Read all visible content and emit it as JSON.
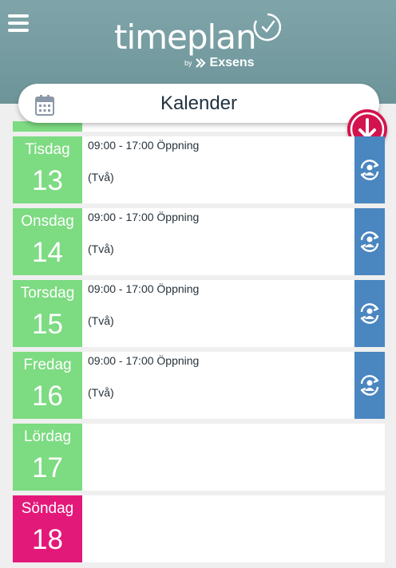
{
  "header": {
    "logo_text": "timeplan",
    "logo_by": "by",
    "logo_brand": "Exsens",
    "menu_icon": "hamburger-menu-icon"
  },
  "calendar_bar": {
    "title": "Kalender",
    "icon": "calendar-icon"
  },
  "scroll_button": {
    "icon": "arrow-down-icon",
    "color": "#d3134e"
  },
  "colors": {
    "weekday": "#7ddb82",
    "sunday": "#e3197a",
    "swap_button": "#4a86c0",
    "header": "#7a9fa4"
  },
  "days": [
    {
      "name": "Tisdag",
      "num": "13",
      "time": "09:00 - 17:00 Öppning",
      "note": "(Två)"
    },
    {
      "name": "Onsdag",
      "num": "14",
      "time": "09:00 - 17:00 Öppning",
      "note": "(Två)"
    },
    {
      "name": "Torsdag",
      "num": "15",
      "time": "09:00 - 17:00 Öppning",
      "note": "(Två)"
    },
    {
      "name": "Fredag",
      "num": "16",
      "time": "09:00 - 17:00 Öppning",
      "note": "(Två)"
    },
    {
      "name": "Lördag",
      "num": "17"
    },
    {
      "name": "Söndag",
      "num": "18"
    }
  ]
}
